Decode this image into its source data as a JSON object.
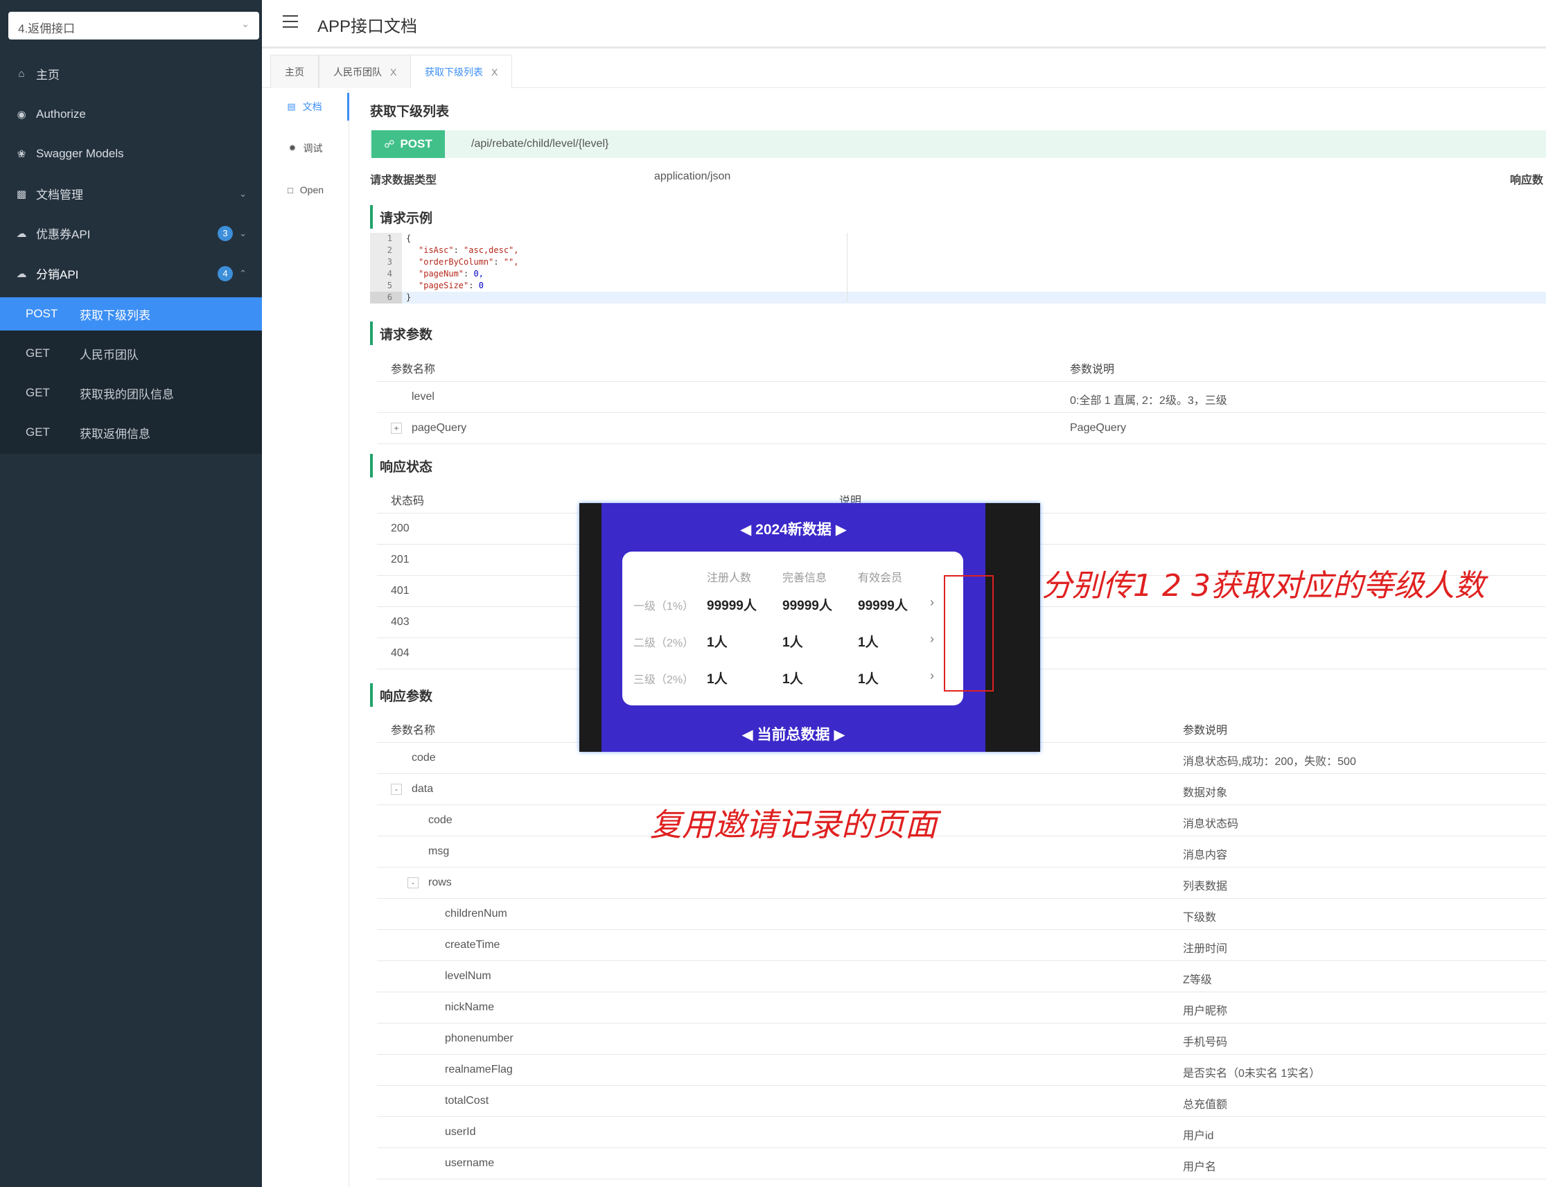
{
  "sidebar": {
    "group_select": "4.返佣接口",
    "menu": [
      {
        "label": "主页",
        "icon": "home-icon"
      },
      {
        "label": "Authorize",
        "icon": "lock-icon"
      },
      {
        "label": "Swagger Models",
        "icon": "settings-icon"
      },
      {
        "label": "文档管理",
        "icon": "doc-manage-icon"
      },
      {
        "label": "优惠券API",
        "icon": "cloud-icon",
        "badge": "3"
      },
      {
        "label": "分销API",
        "icon": "cloud-icon",
        "badge": "4"
      }
    ],
    "sub_items": [
      {
        "method": "POST",
        "label": "获取下级列表",
        "active": true
      },
      {
        "method": "GET",
        "label": "人民币团队"
      },
      {
        "method": "GET",
        "label": "获取我的团队信息"
      },
      {
        "method": "GET",
        "label": "获取返佣信息"
      }
    ]
  },
  "header": {
    "title": "APP接口文档"
  },
  "tabs": [
    {
      "label": "主页"
    },
    {
      "label": "人民币团队",
      "close": "X"
    },
    {
      "label": "获取下级列表",
      "close": "X",
      "active": true
    }
  ],
  "doc_nav": [
    {
      "label": "文档",
      "icon": "doc-icon"
    },
    {
      "label": "调试",
      "icon": "bug-icon"
    },
    {
      "label": "Open",
      "icon": "file-icon"
    }
  ],
  "doc": {
    "title": "获取下级列表",
    "method": "POST",
    "path": "/api/rebate/child/level/{level}",
    "request_type_label": "请求数据类型",
    "request_type_value": "application/json",
    "response_type_label": "响应数",
    "sections": {
      "example": "请求示例",
      "params": "请求参数",
      "status": "响应状态",
      "response": "响应参数"
    },
    "code_lines": [
      {
        "n": "1",
        "text": "{"
      },
      {
        "n": "2",
        "key": "\"isAsc\"",
        "val": "\"asc,desc\","
      },
      {
        "n": "3",
        "key": "\"orderByColumn\"",
        "val": "\"\","
      },
      {
        "n": "4",
        "key": "\"pageNum\"",
        "num": "0,"
      },
      {
        "n": "5",
        "key": "\"pageSize\"",
        "num": "0"
      },
      {
        "n": "6",
        "text": "}"
      }
    ],
    "params_table": {
      "headers": [
        "参数名称",
        "参数说明"
      ],
      "rows": [
        {
          "name": "level",
          "desc": "0:全部 1 直属, 2：2级。3，三级"
        },
        {
          "name": "pageQuery",
          "desc": "PageQuery",
          "expander": "+"
        }
      ]
    },
    "status_table": {
      "headers": [
        "状态码",
        "说明"
      ],
      "rows": [
        "200",
        "201",
        "401",
        "403",
        "404"
      ]
    },
    "response_table": {
      "headers": [
        "参数名称",
        "参数说明"
      ],
      "rows": [
        {
          "name": "code",
          "desc": "消息状态码,成功：200，失败：500",
          "level": 0
        },
        {
          "name": "data",
          "desc": "数据对象",
          "level": 0,
          "expander": "-"
        },
        {
          "name": "code",
          "desc": "消息状态码",
          "level": 1
        },
        {
          "name": "msg",
          "desc": "消息内容",
          "level": 1
        },
        {
          "name": "rows",
          "desc": "列表数据",
          "level": 1,
          "expander": "-"
        },
        {
          "name": "childrenNum",
          "desc": "下级数",
          "level": 2
        },
        {
          "name": "createTime",
          "desc": "注册时间",
          "level": 2
        },
        {
          "name": "levelNum",
          "desc": "Z等级",
          "level": 2
        },
        {
          "name": "nickName",
          "desc": "用户昵称",
          "level": 2
        },
        {
          "name": "phonenumber",
          "desc": "手机号码",
          "level": 2
        },
        {
          "name": "realnameFlag",
          "desc": "是否实名（0未实名 1实名）",
          "level": 2
        },
        {
          "name": "totalCost",
          "desc": "总充值额",
          "level": 2
        },
        {
          "name": "userId",
          "desc": "用户id",
          "level": 2
        },
        {
          "name": "username",
          "desc": "用户名",
          "level": 2
        }
      ]
    }
  },
  "overlay": {
    "title": "2024新数据",
    "headers": [
      "注册人数",
      "完善信息",
      "有效会员"
    ],
    "rows": [
      {
        "level": "一级（1%）",
        "values": [
          "99999人",
          "99999人",
          "99999人"
        ]
      },
      {
        "level": "二级（2%）",
        "values": [
          "1人",
          "1人",
          "1人"
        ]
      },
      {
        "level": "三级（2%）",
        "values": [
          "1人",
          "1人",
          "1人"
        ]
      }
    ],
    "bottom": "当前总数据"
  },
  "annotations": {
    "top": "分别传1 2 3获取对应的等级人数",
    "bottom": "复用邀请记录的页面"
  },
  "colors": {
    "sidebar_bg": "#23313d",
    "active_blue": "#3c8ff5",
    "post_green": "#41c08a",
    "section_bar": "#21a36c",
    "overlay_blue": "#3b29c9",
    "annotation_red": "#e02020"
  }
}
